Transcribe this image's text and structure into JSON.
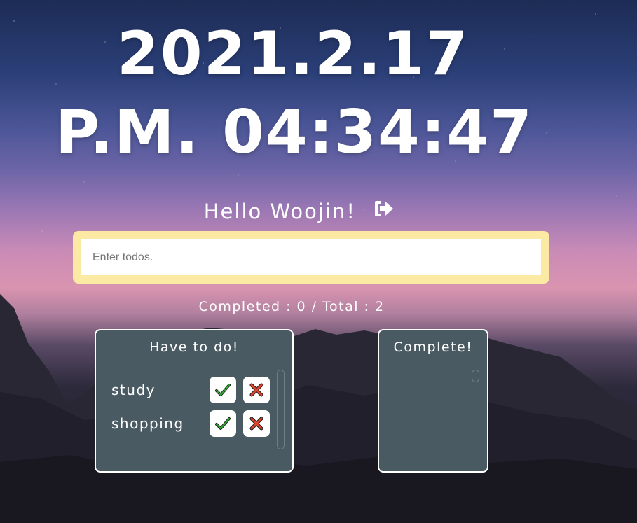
{
  "clock": {
    "date": "2021.2.17",
    "time": "P.M. 04:34:47"
  },
  "greeting": {
    "text": "Hello Woojin!",
    "icon": "sign-out-icon"
  },
  "todo_input": {
    "placeholder": "Enter todos.",
    "value": ""
  },
  "counter": {
    "text": "Completed : 0 / Total : 2"
  },
  "panels": {
    "todo": {
      "title": "Have to do!",
      "items": [
        {
          "text": "study",
          "check_icon": "check-icon",
          "delete_icon": "x-icon"
        },
        {
          "text": "shopping",
          "check_icon": "check-icon",
          "delete_icon": "x-icon"
        }
      ]
    },
    "complete": {
      "title": "Complete!",
      "items": []
    }
  },
  "colors": {
    "input_frame": "#fbe9a4",
    "panel_bg": "#4a5a62",
    "check_green": "#2fa52f",
    "delete_red": "#e0442b"
  }
}
